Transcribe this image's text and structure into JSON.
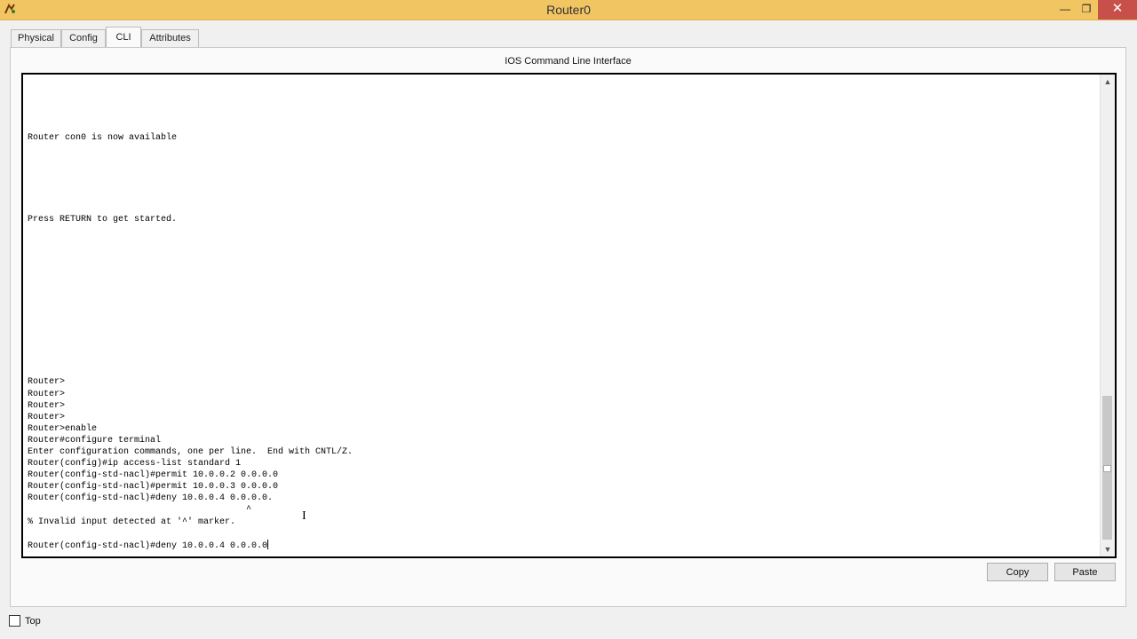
{
  "window": {
    "title": "Router0",
    "minimize_glyph": "—",
    "maximize_glyph": "❐",
    "close_glyph": "✕"
  },
  "tabs": [
    {
      "label": "Physical",
      "active": false
    },
    {
      "label": "Config",
      "active": false
    },
    {
      "label": "CLI",
      "active": true
    },
    {
      "label": "Attributes",
      "active": false
    }
  ],
  "panel": {
    "header": "IOS Command Line Interface"
  },
  "terminal": {
    "lines": [
      "",
      "",
      "",
      "",
      "",
      "Router con0 is now available",
      "",
      "",
      "",
      "",
      "",
      "",
      "Press RETURN to get started.",
      "",
      "",
      "",
      "",
      "",
      "",
      "",
      "",
      "",
      "",
      "",
      "",
      "",
      "Router>",
      "Router>",
      "Router>",
      "Router>",
      "Router>enable",
      "Router#configure terminal",
      "Enter configuration commands, one per line.  End with CNTL/Z.",
      "Router(config)#ip access-list standard 1",
      "Router(config-std-nacl)#permit 10.0.0.2 0.0.0.0",
      "Router(config-std-nacl)#permit 10.0.0.3 0.0.0.0",
      "Router(config-std-nacl)#deny 10.0.0.4 0.0.0.0.",
      "                                         ^",
      "% Invalid input detected at '^' marker.",
      "",
      "Router(config-std-nacl)#deny 10.0.0.4 0.0.0.0"
    ],
    "scroll_up_glyph": "▲",
    "scroll_down_glyph": "▼"
  },
  "buttons": {
    "copy": "Copy",
    "paste": "Paste"
  },
  "footer": {
    "top_label": "Top",
    "top_checked": false
  },
  "colors": {
    "titlebar": "#f2c563",
    "close_button": "#c7504a"
  }
}
